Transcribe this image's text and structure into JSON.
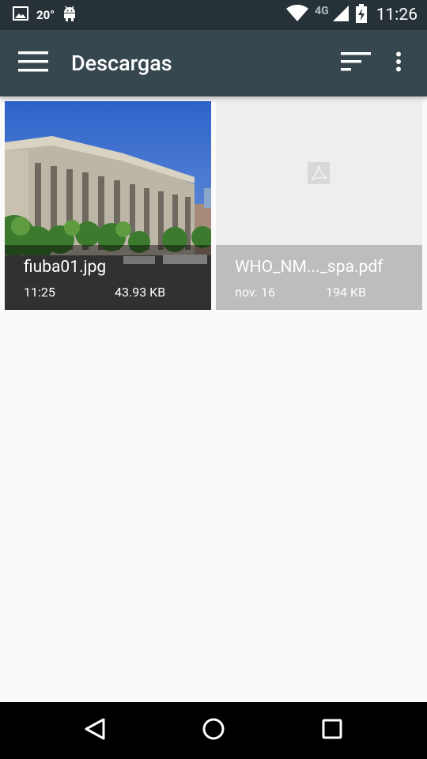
{
  "status_bar": {
    "temperature": "20°",
    "network": "4G",
    "time": "11:26",
    "icons": [
      "gallery-icon",
      "android-icon",
      "wifi-icon",
      "signal-icon",
      "battery-charging-icon"
    ]
  },
  "toolbar": {
    "title": "Descargas",
    "icons": [
      "menu-icon",
      "sort-icon",
      "more-vert-icon"
    ]
  },
  "files": [
    {
      "name": "fiuba01.jpg",
      "date": "11:25",
      "size": "43.93 KB",
      "type": "image"
    },
    {
      "name": "WHO_NM..._spa.pdf",
      "date": "nov. 16",
      "size": "194 KB",
      "type": "pdf"
    }
  ],
  "nav_bar": {
    "icons": [
      "back-icon",
      "home-icon",
      "recents-icon"
    ]
  },
  "colors": {
    "status_bar": "#263238",
    "toolbar": "#37474f",
    "background": "#fafafa",
    "pdf_caption": "#bdbdbd"
  }
}
